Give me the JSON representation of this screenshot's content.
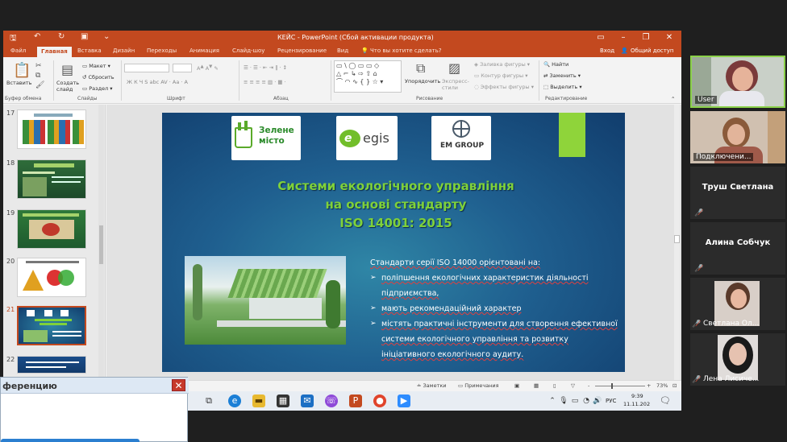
{
  "window": {
    "title": "КЕЙС - PowerPoint (Сбой активации продукта)",
    "autosave_icons": [
      "save-icon",
      "undo-icon",
      "redo-icon",
      "present-icon"
    ]
  },
  "ribbon": {
    "tabs": [
      "Файл",
      "Главная",
      "Вставка",
      "Дизайн",
      "Переходы",
      "Анимация",
      "Слайд-шоу",
      "Рецензирование",
      "Вид"
    ],
    "tell_me": "Что вы хотите сделать?",
    "signin": "Вход",
    "share": "Общий доступ",
    "groups": {
      "clipboard": {
        "label": "Буфер обмена",
        "paste": "Вставить"
      },
      "slides": {
        "label": "Слайды",
        "new_slide": "Создать слайд",
        "layout": "Макет",
        "reset": "Сбросить",
        "section": "Раздел"
      },
      "font": {
        "label": "Шрифт",
        "font_size_a": "A",
        "font_size_a2": "A"
      },
      "paragraph": {
        "label": "Абзац"
      },
      "drawing": {
        "label": "Рисование",
        "arrange": "Упорядочить",
        "quick_styles": "Экспресс-стили",
        "shape_fill": "Заливка фигуры",
        "shape_outline": "Контур фигуры",
        "shape_effects": "Эффекты фигуры"
      },
      "editing": {
        "label": "Редактирование",
        "find": "Найти",
        "replace": "Заменить",
        "select": "Выделить"
      }
    }
  },
  "thumbnails": [
    {
      "num": "17",
      "active": false
    },
    {
      "num": "18",
      "active": false
    },
    {
      "num": "19",
      "active": false
    },
    {
      "num": "20",
      "active": false
    },
    {
      "num": "21",
      "active": true
    },
    {
      "num": "22",
      "active": false
    }
  ],
  "slide": {
    "logos": {
      "zelene": "Зелене місто",
      "egis": "egis",
      "em": "EM GROUP"
    },
    "title_lines": [
      "Системи екологічного управління",
      "на основі стандарту",
      "ISO 14001: 2015"
    ],
    "intro": "Стандарти серії ISO 14000 орієнтовані на:",
    "bullets": [
      "поліпшення екологічних характеристик діяльності підприємства,",
      "мають рекомендаційний характер",
      "містять практичні інструменти для створення ефективної системи екологічного управління та розвитку ініціативного екологічного аудиту."
    ]
  },
  "status": {
    "notes": "Заметки",
    "comments": "Примечания",
    "zoom": "73%",
    "minus": "-",
    "plus": "+"
  },
  "taskbar": {
    "lang": "РУС",
    "time": "9:39",
    "date": "11.11.202"
  },
  "conference": {
    "title": "ференцию",
    "close": "✕"
  },
  "participants": [
    {
      "name": "User",
      "kind": "video"
    },
    {
      "name": "Подключени...",
      "kind": "video"
    },
    {
      "name": "Труш Светлана",
      "kind": "name"
    },
    {
      "name": "Алина Собчук",
      "kind": "name"
    },
    {
      "name": "Светлана Ол...",
      "kind": "video"
    },
    {
      "name": "Лена Лисиче...",
      "kind": "video"
    }
  ],
  "colors": {
    "ppt_accent": "#c3491f",
    "slide_title": "#7fd13a"
  }
}
